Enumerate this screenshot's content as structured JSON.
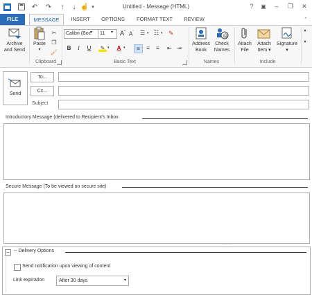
{
  "window": {
    "title": "Untitled - Message (HTML)",
    "help": "?",
    "minimize": "–",
    "restore": "❐",
    "close": "✕"
  },
  "tabs": [
    "FILE",
    "MESSAGE",
    "INSERT",
    "OPTIONS",
    "FORMAT TEXT",
    "REVIEW"
  ],
  "ribbon": {
    "archive": {
      "label1": "Archive",
      "label2": "and Send"
    },
    "paste": "Paste",
    "clipboard_label": "Clipboard",
    "font_name": "Calibri (Boc",
    "font_size": "11",
    "basic_text_label": "Basic Text",
    "names_label": "Names",
    "address_book": {
      "label1": "Address",
      "label2": "Book"
    },
    "check_names": {
      "label1": "Check",
      "label2": "Names"
    },
    "attach_file": {
      "label1": "Attach",
      "label2": "File"
    },
    "attach_item": {
      "label1": "Attach",
      "label2": "Item ▾"
    },
    "signature": {
      "label1": "Signature",
      "label2": "▾"
    },
    "include_label": "Include",
    "bold": "B",
    "italic": "I",
    "underline": "U"
  },
  "header": {
    "send": "Send",
    "to": "To...",
    "cc": "Cc...",
    "subject": "Subject",
    "to_value": "",
    "cc_value": "",
    "subject_value": ""
  },
  "sections": {
    "intro_title": "Introductory Message (delivered to Recipient's Inbox",
    "secure_title": "Secure Message (To be viewed on secure site)",
    "delivery_title": "-- Delivery Options",
    "notify_label": "Send notification upon viewing of content",
    "link_expiration_label": "Link expiration",
    "link_expiration_value": "After 30 days"
  },
  "colors": {
    "accent": "#2b6cb8",
    "border": "#ababab"
  }
}
